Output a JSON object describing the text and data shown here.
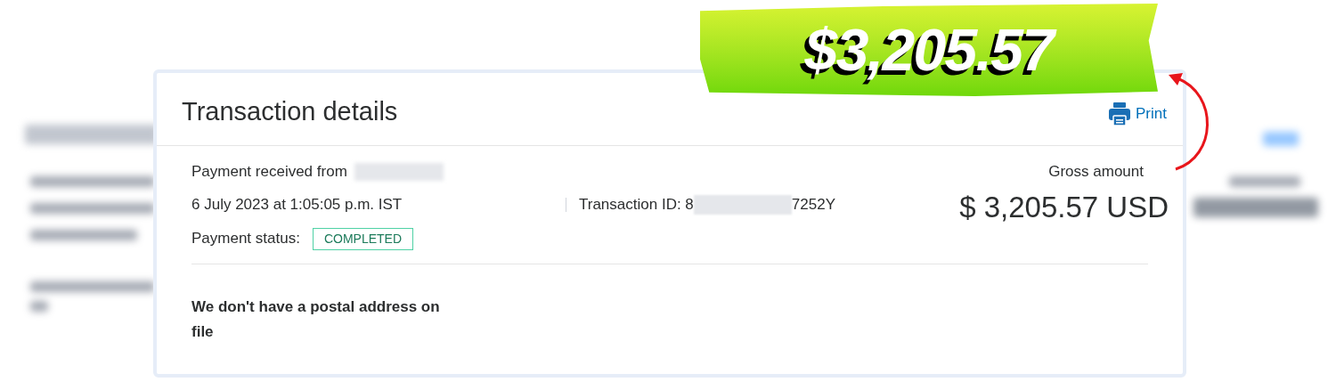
{
  "banner": {
    "amount": "$3,205.57"
  },
  "card": {
    "title": "Transaction details",
    "print": "Print",
    "received_label": "Payment received from",
    "date": "6 July 2023 at 1:05:05 p.m. IST",
    "transaction_id_start": "Transaction ID: 8",
    "transaction_id_end": "7252Y",
    "status_label": "Payment status:",
    "status": "COMPLETED",
    "gross_label": "Gross amount",
    "gross_amount": "$ 3,205.57 USD",
    "address_note": "We don't have a postal address on file"
  }
}
